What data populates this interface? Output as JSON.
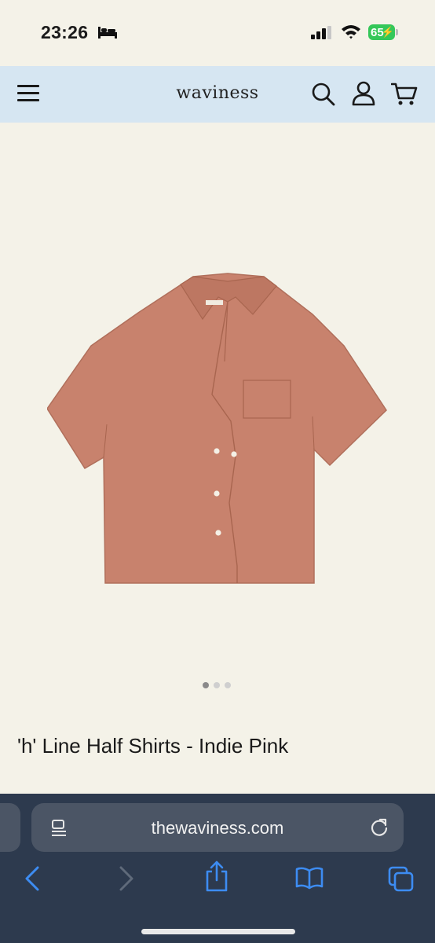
{
  "status_bar": {
    "time": "23:26",
    "battery_level": "65",
    "icons": [
      "bed-icon",
      "cellular-signal-icon",
      "wifi-icon",
      "battery-charging-icon"
    ]
  },
  "header": {
    "logo": "waviness",
    "icons": [
      "menu-icon",
      "search-icon",
      "account-icon",
      "cart-icon"
    ],
    "background": "#d6e6f2"
  },
  "product": {
    "title": "'h' Line Half Shirts - Indie Pink",
    "image_color": "#c8826d",
    "carousel": {
      "total": 3,
      "active": 1
    }
  },
  "browser": {
    "url": "thewaviness.com",
    "toolbar": [
      "back-icon",
      "forward-icon",
      "share-icon",
      "bookmarks-icon",
      "tabs-icon"
    ],
    "accent": "#3d8cf2"
  }
}
